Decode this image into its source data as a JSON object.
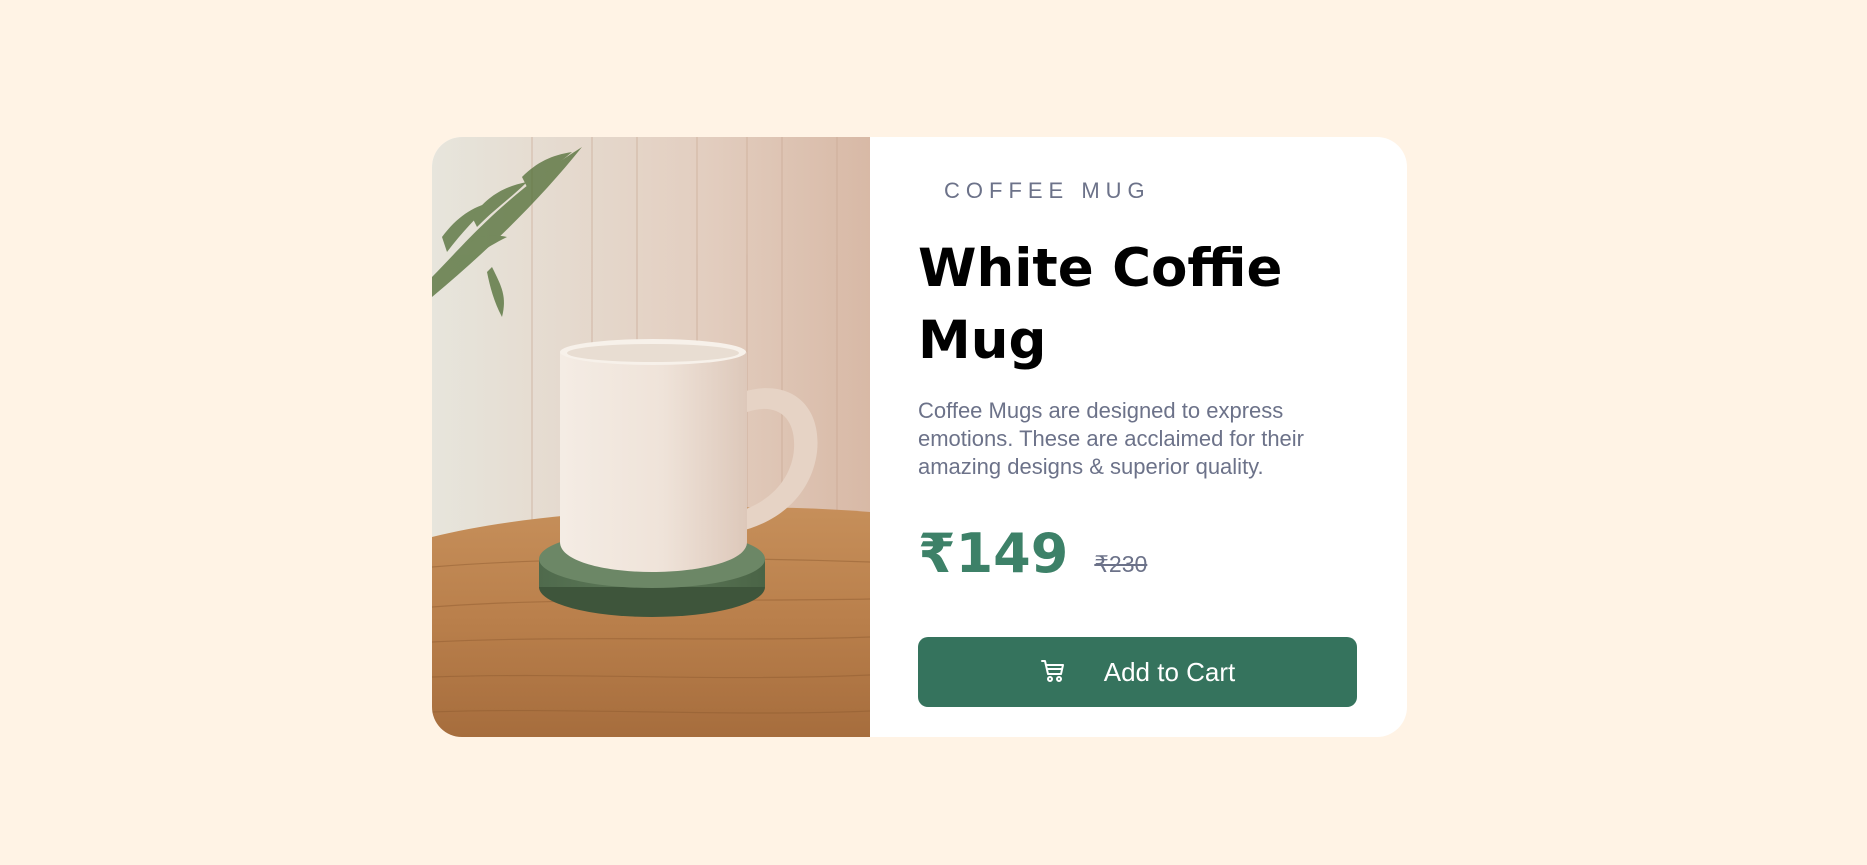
{
  "product": {
    "category": "COFFEE MUG",
    "title": "White Coffie Mug",
    "description": "Coffee Mugs are designed to express emotions. These are acclaimed for their amazing designs & superior quality.",
    "price": "₹149",
    "original_price": "₹230",
    "add_to_cart_label": "Add to Cart",
    "cart_icon": "cart-icon"
  },
  "colors": {
    "background": "#fff3e5",
    "card": "#ffffff",
    "accent": "#35735d",
    "price": "#3d8168",
    "muted_text": "#6c7289"
  }
}
